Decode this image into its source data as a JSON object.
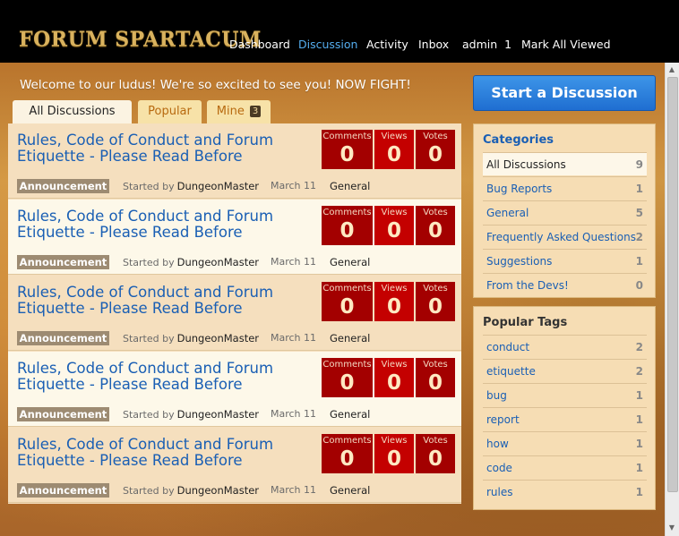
{
  "brand": {
    "logo_text": "FORUM SPARTACUM"
  },
  "nav": {
    "items": [
      {
        "label": "Dashboard"
      },
      {
        "label": "Discussion"
      },
      {
        "label": "Activity"
      },
      {
        "label": "Inbox"
      },
      {
        "label": "admin",
        "badge": "1"
      },
      {
        "label": "Mark All Viewed"
      }
    ]
  },
  "welcome": "Welcome to our ludus! We're so excited to see you! NOW FIGHT!",
  "tabs": [
    {
      "label": "All Discussions"
    },
    {
      "label": "Popular"
    },
    {
      "label": "Mine",
      "count": "3"
    }
  ],
  "count_labels": {
    "comments": "Comments",
    "views": "Views",
    "votes": "Votes"
  },
  "discussions": [
    {
      "title": "Rules, Code of Conduct and Forum Etiquette - Please Read Before",
      "comments": "0",
      "views": "0",
      "votes": "0",
      "tag": "Announcement",
      "started_by": "Started by",
      "author": "DungeonMaster",
      "date": "March 11",
      "category": "General"
    },
    {
      "title": "Rules, Code of Conduct and Forum Etiquette - Please Read Before",
      "comments": "0",
      "views": "0",
      "votes": "0",
      "tag": "Announcement",
      "started_by": "Started by",
      "author": "DungeonMaster",
      "date": "March 11",
      "category": "General"
    },
    {
      "title": "Rules, Code of Conduct and Forum Etiquette - Please Read Before",
      "comments": "0",
      "views": "0",
      "votes": "0",
      "tag": "Announcement",
      "started_by": "Started by",
      "author": "DungeonMaster",
      "date": "March 11",
      "category": "General"
    },
    {
      "title": "Rules, Code of Conduct and Forum Etiquette - Please Read Before",
      "comments": "0",
      "views": "0",
      "votes": "0",
      "tag": "Announcement",
      "started_by": "Started by",
      "author": "DungeonMaster",
      "date": "March 11",
      "category": "General"
    },
    {
      "title": "Rules, Code of Conduct and Forum Etiquette - Please Read Before",
      "comments": "0",
      "views": "0",
      "votes": "0",
      "tag": "Announcement",
      "started_by": "Started by",
      "author": "DungeonMaster",
      "date": "March 11",
      "category": "General"
    }
  ],
  "sidebar": {
    "start_button": "Start a Discussion",
    "categories_title": "Categories",
    "categories": [
      {
        "label": "All Discussions",
        "count": "9"
      },
      {
        "label": "Bug Reports",
        "count": "1"
      },
      {
        "label": "General",
        "count": "5"
      },
      {
        "label": "Frequently Asked Questions",
        "count": "2"
      },
      {
        "label": "Suggestions",
        "count": "1"
      },
      {
        "label": "From the Devs!",
        "count": "0"
      }
    ],
    "tags_title": "Popular Tags",
    "tags": [
      {
        "label": "conduct",
        "count": "2"
      },
      {
        "label": "etiquette",
        "count": "2"
      },
      {
        "label": "bug",
        "count": "1"
      },
      {
        "label": "report",
        "count": "1"
      },
      {
        "label": "how",
        "count": "1"
      },
      {
        "label": "code",
        "count": "1"
      },
      {
        "label": "rules",
        "count": "1"
      }
    ]
  },
  "colors": {
    "nav_active": "#55aef0",
    "link": "#1a5fb4",
    "count_box": "#a30000",
    "button": "#1f6ed1"
  }
}
